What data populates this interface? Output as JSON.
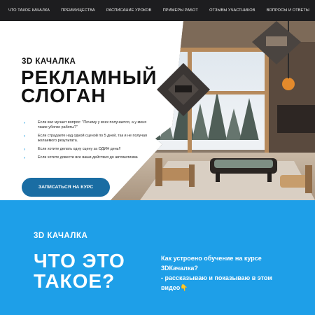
{
  "nav": {
    "items": [
      {
        "label": "ЧТО ТАКОЕ КАЧАЛКА"
      },
      {
        "label": "ПРЕИМУЩЕСТВА"
      },
      {
        "label": "РАСПИСАНИЕ УРОКОВ"
      },
      {
        "label": "ПРИМЕРЫ РАБОТ"
      },
      {
        "label": "ОТЗЫВЫ УЧАСТНИКОВ"
      },
      {
        "label": "ВОПРОСЫ И ОТВЕТЫ"
      }
    ]
  },
  "hero": {
    "brand": "3D КАЧАЛКА",
    "slogan_line1": "РЕКЛАМНЫЙ",
    "slogan_line2": "СЛОГАН",
    "bullets": [
      "Если вас мучает вопрос: \"Почему у всех получается, а у меня такие убогие работы?\"",
      "Если страдаете над одной сценой по 5 дней, так и не получая желаемого результата.",
      "Если хотите делать одну сцену за ОДИН день!!",
      "Если хотите довести все ваши действия до автоматизма"
    ],
    "cta_label": "ЗАПИСАТЬСЯ НА КУРС"
  },
  "about": {
    "brand": "3D КАЧАЛКА",
    "title_line1": "ЧТО ЭТО",
    "title_line2": "ТАКОЕ?",
    "text_line1": "Как устроено обучение на курсе",
    "text_line2": "3DКачалка?",
    "text_line3": "- рассказываю и показываю в этом",
    "text_line4": "видео",
    "hand_emoji": "👇"
  },
  "colors": {
    "nav_bg": "#1d1d1f",
    "cta": "#1a6da3",
    "blue_section": "#1e9fe8",
    "bullet_accent": "#1a9be0"
  },
  "icons": {
    "bullet": "chevron-right-icon",
    "pointer": "hand-pointing-down-icon"
  }
}
